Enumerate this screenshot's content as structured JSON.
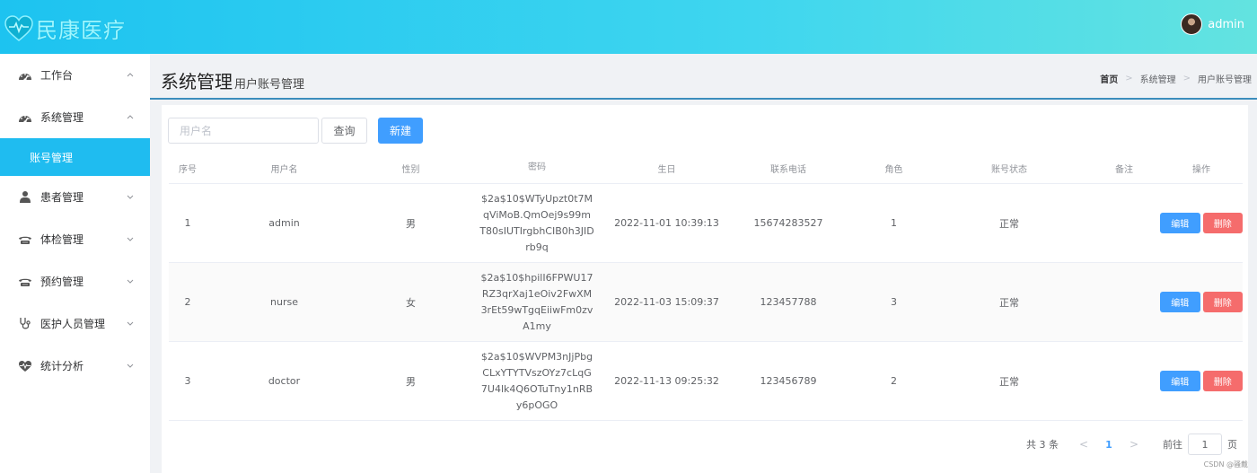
{
  "app": {
    "logo_text": "民康医疗",
    "user_name": "admin"
  },
  "sidebar": {
    "items": [
      {
        "label": "工作台",
        "icon": "gauge-icon",
        "chevron": "up"
      },
      {
        "label": "系统管理",
        "icon": "gauge-icon",
        "chevron": "up",
        "expanded": true,
        "children": [
          {
            "label": "账号管理",
            "active": true
          }
        ]
      },
      {
        "label": "患者管理",
        "icon": "person-icon",
        "chevron": "down"
      },
      {
        "label": "体检管理",
        "icon": "phone-icon",
        "chevron": "down"
      },
      {
        "label": "预约管理",
        "icon": "phone-icon",
        "chevron": "down"
      },
      {
        "label": "医护人员管理",
        "icon": "stethoscope-icon",
        "chevron": "down"
      },
      {
        "label": "统计分析",
        "icon": "heartbeat-icon",
        "chevron": "down"
      }
    ]
  },
  "page": {
    "title": "系统管理",
    "subtitle": "用户账号管理"
  },
  "breadcrumb": [
    "首页",
    "系统管理",
    "用户账号管理"
  ],
  "toolbar": {
    "search_placeholder": "用户名",
    "search_value": "",
    "query_label": "查询",
    "new_label": "新建"
  },
  "table": {
    "columns": [
      "序号",
      "用户名",
      "性别",
      "密码",
      "生日",
      "联系电话",
      "角色",
      "账号状态",
      "备注",
      "操作"
    ],
    "rows": [
      {
        "index": "1",
        "username": "admin",
        "gender": "男",
        "password_lines": [
          "$2a$10$WTyUpzt0t7M",
          "qViMoB.QmOej9s99m",
          "T80sIUTIrgbhCIB0h3JID",
          "rb9q"
        ],
        "birthday": "2022-11-01 10:39:13",
        "phone": "15674283527",
        "role": "1",
        "status": "正常",
        "remark": ""
      },
      {
        "index": "2",
        "username": "nurse",
        "gender": "女",
        "password_lines": [
          "$2a$10$hpilI6FPWU17",
          "RZ3qrXaj1eOiv2FwXM",
          "3rEt59wTgqEiiwFm0zv",
          "A1my"
        ],
        "birthday": "2022-11-03 15:09:37",
        "phone": "123457788",
        "role": "3",
        "status": "正常",
        "remark": ""
      },
      {
        "index": "3",
        "username": "doctor",
        "gender": "男",
        "password_lines": [
          "$2a$10$WVPM3nJjPbg",
          "CLxYTYTVszOYz7cLqG",
          "7U4lk4Q6OTuTny1nRB",
          "y6pOGO"
        ],
        "birthday": "2022-11-13 09:25:32",
        "phone": "123456789",
        "role": "2",
        "status": "正常",
        "remark": ""
      }
    ],
    "edit_label": "编辑",
    "delete_label": "删除"
  },
  "pagination": {
    "total_text": "共 3 条",
    "current_page": "1",
    "goto_label": "前往",
    "goto_value": "1",
    "page_unit": "页"
  },
  "watermark": "CSDN @骚戴",
  "colors": {
    "header_start": "#1dc3f0",
    "header_end": "#63e3e0",
    "active_menu": "#1fbcf0",
    "primary": "#409eff",
    "danger": "#f56c6c"
  }
}
